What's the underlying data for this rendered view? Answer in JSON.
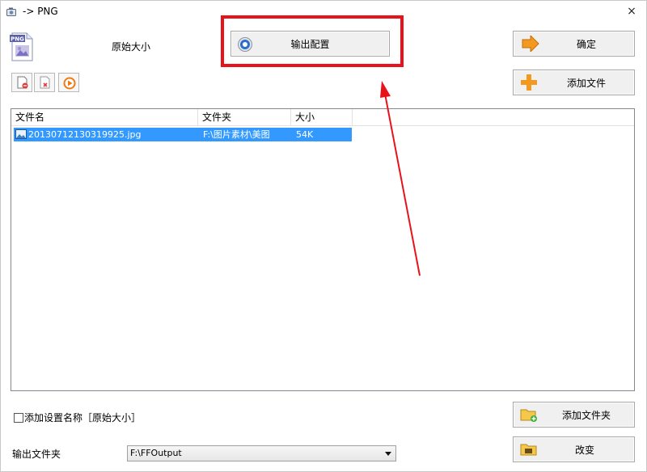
{
  "window": {
    "title": "-> PNG",
    "close_glyph": "×"
  },
  "header": {
    "format_icon": "png-file-icon",
    "format_badge": "PNG",
    "preset_label": "原始大小"
  },
  "buttons": {
    "output_config": "输出配置",
    "ok": "确定",
    "add_file": "添加文件",
    "add_folder": "添加文件夹",
    "change": "改变"
  },
  "toolbar": {
    "icons": [
      "remove-file-icon",
      "clear-list-icon",
      "play-icon"
    ]
  },
  "file_list": {
    "columns": [
      "文件名",
      "文件夹",
      "大小"
    ],
    "rows": [
      {
        "name": "20130712130319925.jpg",
        "folder": "F:\\图片素材\\美图",
        "size": "54K",
        "selected": true
      }
    ]
  },
  "options": {
    "add_setting_name": "添加设置名称［原始大小］",
    "checked": false
  },
  "output": {
    "label": "输出文件夹",
    "value": "F:\\FFOutput"
  },
  "annotation": {
    "highlight_color": "#e8131a",
    "arrow_color": "#e8131a"
  },
  "colors": {
    "selection": "#3399ff"
  }
}
